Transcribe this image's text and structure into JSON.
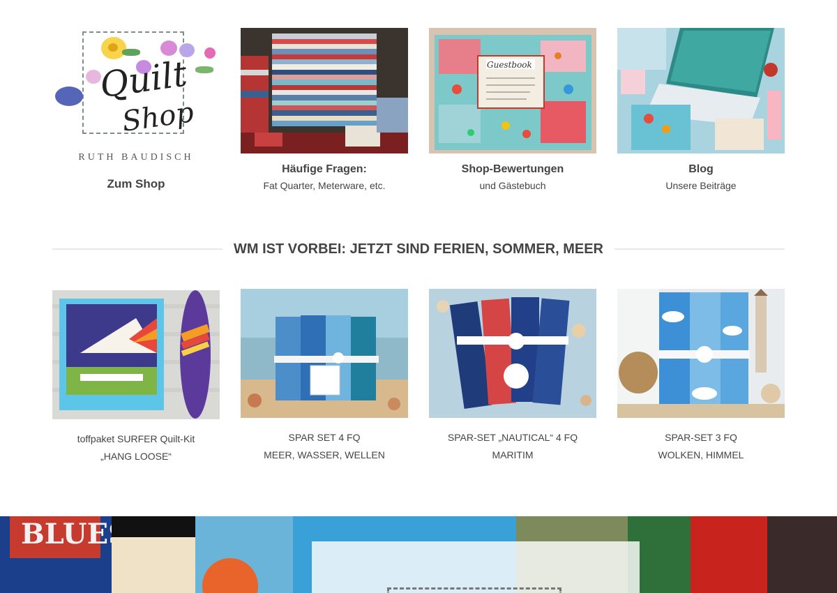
{
  "top_links": [
    {
      "title": "Zum Shop",
      "subtitle": ""
    },
    {
      "title": "Häufige Fragen:",
      "subtitle": "Fat Quarter, Meterware, etc."
    },
    {
      "title": "Shop-Bewertungen",
      "subtitle": "und Gästebuch"
    },
    {
      "title": "Blog",
      "subtitle": "Unsere Beiträge"
    }
  ],
  "logo": {
    "line1": "Quilt",
    "line2": "Shop",
    "name": "RUTH BAUDISCH",
    "guestbook_text": "Guestbook"
  },
  "section": {
    "heading": "WM IST VORBEI: JETZT SIND FERIEN, SOMMER, MEER"
  },
  "products": [
    {
      "line1": "toffpaket SURFER Quilt-Kit",
      "line2": "„HANG LOOSE“"
    },
    {
      "line1": "SPAR SET 4 FQ",
      "line2": "MEER, WASSER, WELLEN"
    },
    {
      "line1": "SPAR-SET „NAUTICAL“ 4 FQ",
      "line2": "MARITIM"
    },
    {
      "line1": "SPAR-SET 3 FQ",
      "line2": "WOLKEN, HIMMEL"
    }
  ],
  "banner": {
    "fabric_text": "BLUES"
  },
  "colors": {
    "text": "#444444",
    "divider": "#e8e8e8"
  }
}
